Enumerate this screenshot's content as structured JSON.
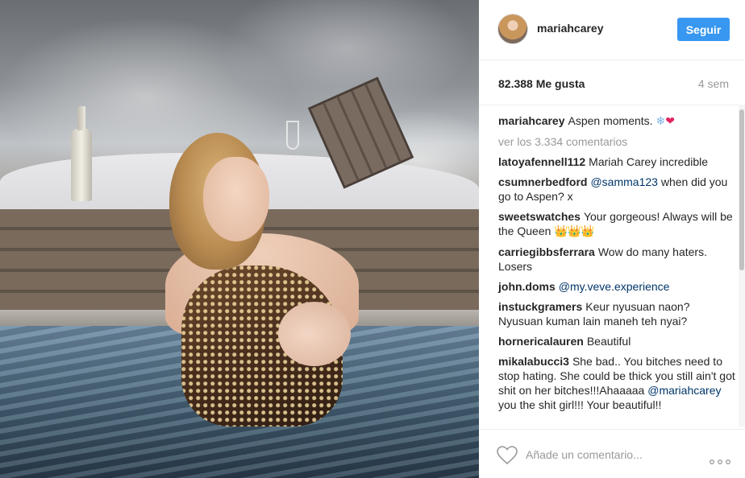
{
  "header": {
    "username": "mariahcarey",
    "follow_label": "Seguir"
  },
  "stats": {
    "likes": "82.388 Me gusta",
    "time": "4 sem"
  },
  "caption": {
    "user": "mariahcarey",
    "text": "Aspen moments.",
    "emoji": [
      "snowflake-emoji",
      "red-heart-emoji"
    ]
  },
  "view_all": "ver los 3.334 comentarios",
  "comments": [
    {
      "user": "latoyafennell112",
      "text": "Mariah Carey incredible"
    },
    {
      "user": "csumnerbedford",
      "mention": "@samma123",
      "text": "when did you go to Aspen? x"
    },
    {
      "user": "sweetswatches",
      "text": "Your gorgeous! Always will be the Queen",
      "emoji": "👑👑👑"
    },
    {
      "user": "carriegibbsferrara",
      "text": "Wow do many haters. Losers"
    },
    {
      "user": "john.doms",
      "mention": "@my.veve.experience"
    },
    {
      "user": "instuckgramers",
      "text": "Keur nyusuan naon? Nyusuan kuman lain maneh teh nyai?"
    },
    {
      "user": "hornericalauren",
      "text": "Beautiful"
    },
    {
      "user": "mikalabucci3",
      "text": "She bad.. You bitches need to stop hating. She could be thick you still ain't got shit on her bitches!!!Ahaaaaa",
      "mention": "@mariahcarey",
      "text2": "you the shit girl!!! Your beautiful!!"
    }
  ],
  "footer": {
    "comment_placeholder": "Añade un comentario...",
    "like_icon": "heart-outline-icon",
    "more_icon": "more-options-icon"
  },
  "colors": {
    "accent": "#3897f0",
    "mention": "#003569",
    "muted": "#999999"
  }
}
